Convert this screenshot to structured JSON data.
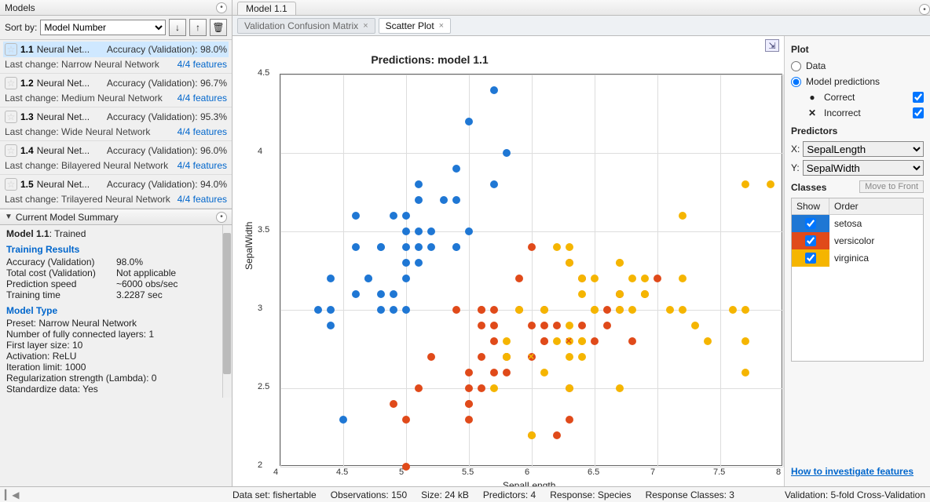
{
  "left": {
    "models_title": "Models",
    "sort_label": "Sort by:",
    "sort_options": [
      "Model Number"
    ],
    "sort_selected": "Model Number",
    "items": [
      {
        "id": "1.1",
        "name": "Neural Net...",
        "accuracy": "Accuracy (Validation): 98.0%",
        "last": "Last change: Narrow Neural Network",
        "features": "4/4 features",
        "selected": true
      },
      {
        "id": "1.2",
        "name": "Neural Net...",
        "accuracy": "Accuracy (Validation): 96.7%",
        "last": "Last change: Medium Neural Network",
        "features": "4/4 features"
      },
      {
        "id": "1.3",
        "name": "Neural Net...",
        "accuracy": "Accuracy (Validation): 95.3%",
        "last": "Last change: Wide Neural Network",
        "features": "4/4 features"
      },
      {
        "id": "1.4",
        "name": "Neural Net...",
        "accuracy": "Accuracy (Validation): 96.0%",
        "last": "Last change: Bilayered Neural Network",
        "features": "4/4 features"
      },
      {
        "id": "1.5",
        "name": "Neural Net...",
        "accuracy": "Accuracy (Validation): 94.0%",
        "last": "Last change: Trilayered Neural Network",
        "features": "4/4 features"
      }
    ],
    "summary_title": "Current Model Summary",
    "summary": {
      "model_label": "Model 1.1",
      "model_state": ": Trained",
      "training_results_title": "Training Results",
      "rows": [
        {
          "k": "Accuracy (Validation)",
          "v": "98.0%"
        },
        {
          "k": "Total cost (Validation)",
          "v": "Not applicable"
        },
        {
          "k": "Prediction speed",
          "v": "~6000 obs/sec"
        },
        {
          "k": "Training time",
          "v": "3.2287 sec"
        }
      ],
      "model_type_title": "Model Type",
      "mt_rows": [
        "Preset: Narrow Neural Network",
        "Number of fully connected layers: 1",
        "First layer size: 10",
        "Activation: ReLU",
        "Iteration limit: 1000",
        "Regularization strength (Lambda): 0",
        "Standardize data: Yes"
      ]
    }
  },
  "doc": {
    "tab": "Model 1.1",
    "subtabs": [
      {
        "label": "Validation Confusion Matrix",
        "active": false
      },
      {
        "label": "Scatter Plot",
        "active": true
      }
    ]
  },
  "plot": {
    "title": "Predictions: model 1.1",
    "xlabel": "SepalLength",
    "ylabel": "SepalWidth"
  },
  "plot_side": {
    "plot_title": "Plot",
    "radio_data": "Data",
    "radio_pred": "Model predictions",
    "correct": "Correct",
    "incorrect": "Incorrect",
    "predictors_title": "Predictors",
    "x_label": "X:",
    "y_label": "Y:",
    "x_sel": "SepalLength",
    "y_sel": "SepalWidth",
    "classes_title": "Classes",
    "mtf": "Move to Front",
    "show": "Show",
    "order": "Order",
    "classes": [
      {
        "name": "setosa",
        "color": "#1f77d4"
      },
      {
        "name": "versicolor",
        "color": "#e04a1a"
      },
      {
        "name": "virginica",
        "color": "#f5b500"
      }
    ],
    "how_link": "How to investigate features"
  },
  "status": {
    "dataset": "Data set: fishertable",
    "obs": "Observations: 150",
    "size": "Size: 24 kB",
    "preds": "Predictors: 4",
    "resp": "Response: Species",
    "rclasses": "Response Classes: 3",
    "validation": "Validation: 5-fold Cross-Validation"
  },
  "chart_data": {
    "type": "scatter",
    "title": "Predictions: model 1.1",
    "xlabel": "SepalLength",
    "ylabel": "SepalWidth",
    "xlim": [
      4,
      8
    ],
    "ylim": [
      2,
      4.5
    ],
    "xticks": [
      4,
      4.5,
      5,
      5.5,
      6,
      6.5,
      7,
      7.5,
      8
    ],
    "yticks": [
      2,
      2.5,
      3,
      3.5,
      4,
      4.5
    ],
    "classes": [
      "setosa",
      "versicolor",
      "virginica"
    ],
    "colors": [
      "#1f77d4",
      "#e04a1a",
      "#f5b500"
    ],
    "series": [
      {
        "name": "setosa",
        "marker": "o",
        "points": [
          [
            5.1,
            3.5
          ],
          [
            4.9,
            3.0
          ],
          [
            4.7,
            3.2
          ],
          [
            4.6,
            3.1
          ],
          [
            5.0,
            3.6
          ],
          [
            5.4,
            3.9
          ],
          [
            4.6,
            3.4
          ],
          [
            5.0,
            3.4
          ],
          [
            4.4,
            2.9
          ],
          [
            4.9,
            3.1
          ],
          [
            5.4,
            3.7
          ],
          [
            4.8,
            3.4
          ],
          [
            4.8,
            3.0
          ],
          [
            5.8,
            4.0
          ],
          [
            5.7,
            4.4
          ],
          [
            5.4,
            3.4
          ],
          [
            5.1,
            3.7
          ],
          [
            5.1,
            3.3
          ],
          [
            4.8,
            3.1
          ],
          [
            5.0,
            3.0
          ],
          [
            5.0,
            3.2
          ],
          [
            5.2,
            3.5
          ],
          [
            4.7,
            3.2
          ],
          [
            5.5,
            4.2
          ],
          [
            4.9,
            3.6
          ],
          [
            5.0,
            3.5
          ],
          [
            5.5,
            3.5
          ],
          [
            4.4,
            3.0
          ],
          [
            5.1,
            3.4
          ],
          [
            4.5,
            2.3
          ],
          [
            5.3,
            3.7
          ],
          [
            5.0,
            3.3
          ],
          [
            5.7,
            3.8
          ],
          [
            5.1,
            3.8
          ],
          [
            4.6,
            3.6
          ],
          [
            4.3,
            3.0
          ],
          [
            4.4,
            3.2
          ],
          [
            4.8,
            3.4
          ],
          [
            5.2,
            3.4
          ],
          [
            5.4,
            3.4
          ]
        ]
      },
      {
        "name": "versicolor",
        "marker": "o",
        "points": [
          [
            7.0,
            3.2
          ],
          [
            6.4,
            3.2
          ],
          [
            6.9,
            3.1
          ],
          [
            5.5,
            2.3
          ],
          [
            6.5,
            2.8
          ],
          [
            5.7,
            2.8
          ],
          [
            6.3,
            3.3
          ],
          [
            4.9,
            2.4
          ],
          [
            6.6,
            2.9
          ],
          [
            5.2,
            2.7
          ],
          [
            5.0,
            2.0
          ],
          [
            5.9,
            3.0
          ],
          [
            6.0,
            2.2
          ],
          [
            6.1,
            2.9
          ],
          [
            5.6,
            2.9
          ],
          [
            6.7,
            3.1
          ],
          [
            5.6,
            3.0
          ],
          [
            5.8,
            2.7
          ],
          [
            6.2,
            2.2
          ],
          [
            5.6,
            2.5
          ],
          [
            5.9,
            3.2
          ],
          [
            6.1,
            2.8
          ],
          [
            6.3,
            2.5
          ],
          [
            6.1,
            2.8
          ],
          [
            6.4,
            2.9
          ],
          [
            6.6,
            3.0
          ],
          [
            6.8,
            2.8
          ],
          [
            6.7,
            3.0
          ],
          [
            6.0,
            2.9
          ],
          [
            5.7,
            2.6
          ],
          [
            5.5,
            2.4
          ],
          [
            5.5,
            2.4
          ],
          [
            5.8,
            2.7
          ],
          [
            6.0,
            2.7
          ],
          [
            5.4,
            3.0
          ],
          [
            6.0,
            3.4
          ],
          [
            6.7,
            3.1
          ],
          [
            6.3,
            2.3
          ],
          [
            5.6,
            3.0
          ],
          [
            5.5,
            2.5
          ],
          [
            5.5,
            2.6
          ],
          [
            6.1,
            3.0
          ],
          [
            5.8,
            2.6
          ],
          [
            5.0,
            2.3
          ],
          [
            5.6,
            2.7
          ],
          [
            5.7,
            3.0
          ],
          [
            5.7,
            2.9
          ],
          [
            6.2,
            2.9
          ],
          [
            5.1,
            2.5
          ]
        ]
      },
      {
        "name": "virginica",
        "marker": "o",
        "points": [
          [
            6.3,
            3.3
          ],
          [
            5.8,
            2.7
          ],
          [
            7.1,
            3.0
          ],
          [
            6.3,
            2.9
          ],
          [
            6.5,
            3.0
          ],
          [
            7.6,
            3.0
          ],
          [
            7.3,
            2.9
          ],
          [
            6.7,
            2.5
          ],
          [
            7.2,
            3.6
          ],
          [
            6.5,
            3.2
          ],
          [
            6.4,
            2.7
          ],
          [
            6.8,
            3.0
          ],
          [
            5.7,
            2.5
          ],
          [
            5.8,
            2.8
          ],
          [
            6.4,
            3.2
          ],
          [
            6.5,
            3.0
          ],
          [
            7.7,
            3.8
          ],
          [
            7.7,
            2.6
          ],
          [
            6.0,
            2.2
          ],
          [
            6.9,
            3.2
          ],
          [
            7.7,
            2.8
          ],
          [
            6.3,
            2.7
          ],
          [
            6.7,
            3.3
          ],
          [
            7.2,
            3.2
          ],
          [
            6.2,
            2.8
          ],
          [
            6.1,
            3.0
          ],
          [
            6.4,
            2.8
          ],
          [
            7.2,
            3.0
          ],
          [
            7.4,
            2.8
          ],
          [
            7.9,
            3.8
          ],
          [
            6.4,
            2.8
          ],
          [
            6.3,
            2.8
          ],
          [
            6.1,
            2.6
          ],
          [
            7.7,
            3.0
          ],
          [
            6.3,
            3.4
          ],
          [
            6.4,
            3.1
          ],
          [
            6.9,
            3.1
          ],
          [
            6.7,
            3.1
          ],
          [
            6.9,
            3.1
          ],
          [
            5.8,
            2.7
          ],
          [
            6.8,
            3.2
          ],
          [
            6.7,
            3.3
          ],
          [
            6.7,
            3.0
          ],
          [
            6.3,
            2.5
          ],
          [
            6.5,
            3.0
          ],
          [
            6.2,
            3.4
          ],
          [
            5.9,
            3.0
          ]
        ]
      },
      {
        "name": "incorrect",
        "marker": "x",
        "class": "versicolor",
        "points": [
          [
            6.3,
            2.8
          ]
        ]
      },
      {
        "name": "incorrect",
        "marker": "x",
        "class": "virginica",
        "points": [
          [
            6.0,
            2.7
          ]
        ]
      }
    ]
  }
}
